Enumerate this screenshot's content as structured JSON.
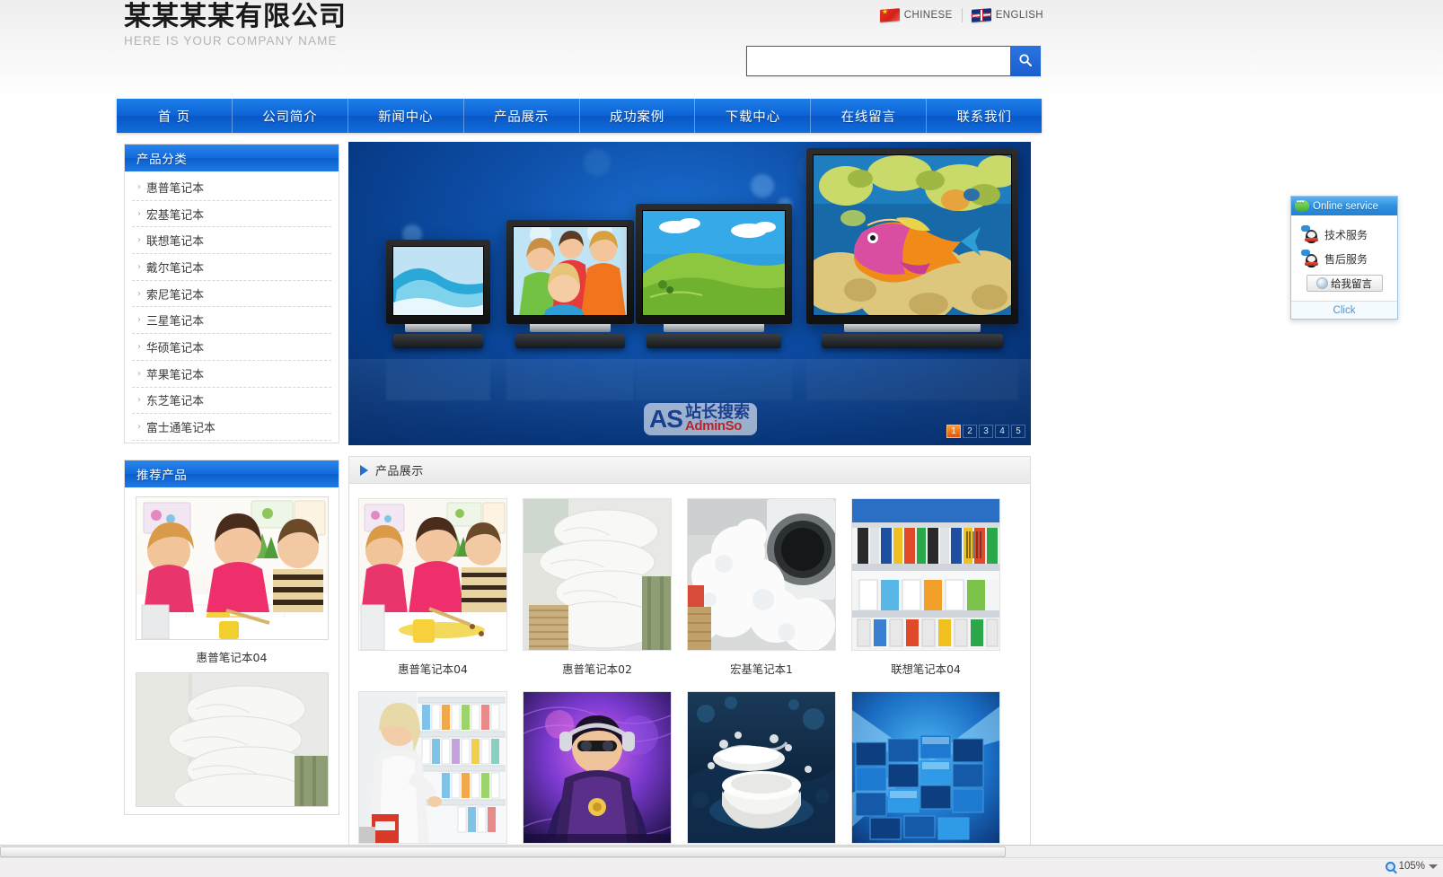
{
  "header": {
    "logo_cn": "某某某某有限公司",
    "logo_en": "HERE IS YOUR COMPANY NAME",
    "languages": [
      {
        "label": "CHINESE",
        "icon": "flag-cn-icon"
      },
      {
        "label": "ENGLISH",
        "icon": "flag-uk-icon"
      }
    ],
    "search": {
      "value": "",
      "placeholder": "",
      "button_icon": "search-icon"
    }
  },
  "nav": {
    "items": [
      "首 页",
      "公司简介",
      "新闻中心",
      "产品展示",
      "成功案例",
      "下载中心",
      "在线留言",
      "联系我们"
    ]
  },
  "sidebar": {
    "category_panel": {
      "title": "产品分类",
      "items": [
        "惠普笔记本",
        "宏基笔记本",
        "联想笔记本",
        "戴尔笔记本",
        "索尼笔记本",
        "三星笔记本",
        "华硕笔记本",
        "苹果笔记本",
        "东芝笔记本",
        "富士通笔记本"
      ]
    },
    "promo_panel": {
      "title": "推荐产品",
      "items": [
        {
          "caption": "惠普笔记本04",
          "image": "kids-painting-photo"
        },
        {
          "caption": "",
          "image": "white-pillows-photo"
        }
      ]
    }
  },
  "banner": {
    "image": "four-flat-screen-tvs-on-blue-background",
    "watermark": {
      "mark": "AS",
      "cn": "站长搜索",
      "en": "AdminSo"
    },
    "pager": [
      "1",
      "2",
      "3",
      "4",
      "5"
    ],
    "active_page": "1"
  },
  "showcase": {
    "title": "产品展示",
    "marker_icon": "triangle-right-icon",
    "products": [
      {
        "caption": "惠普笔记本04",
        "image": "kids-painting-photo"
      },
      {
        "caption": "惠普笔记本02",
        "image": "white-pillows-photo"
      },
      {
        "caption": "宏基笔记本1",
        "image": "washing-machine-foam-photo"
      },
      {
        "caption": "联想笔记本04",
        "image": "stationery-shelf-photo"
      },
      {
        "caption": "",
        "image": "woman-in-pharmacy-photo"
      },
      {
        "caption": "",
        "image": "dj-with-headphones-photo"
      },
      {
        "caption": "",
        "image": "cream-jar-splash-photo"
      },
      {
        "caption": "",
        "image": "video-wall-screens-photo"
      }
    ]
  },
  "online_service": {
    "title": "Online service",
    "title_icon": "chat-bubble-icon",
    "rows": [
      {
        "label": "技术服务",
        "icon": "qq-penguin-icon"
      },
      {
        "label": "售后服务",
        "icon": "qq-penguin-icon"
      }
    ],
    "message_button": {
      "label": "给我留言",
      "icon": "message-circle-icon"
    },
    "footer": "Click"
  },
  "browser": {
    "zoom_level": "105%",
    "zoom_icon": "zoom-magnifier-icon",
    "caret_icon": "chevron-down-icon"
  },
  "colors": {
    "nav_blue": "#0c63d6",
    "panel_header_blue": "#1169dc",
    "accent_orange": "#e2540b",
    "banner_blue": "#0d4ea8",
    "text_dark": "#333333",
    "muted_gray": "#b4b4b4"
  }
}
